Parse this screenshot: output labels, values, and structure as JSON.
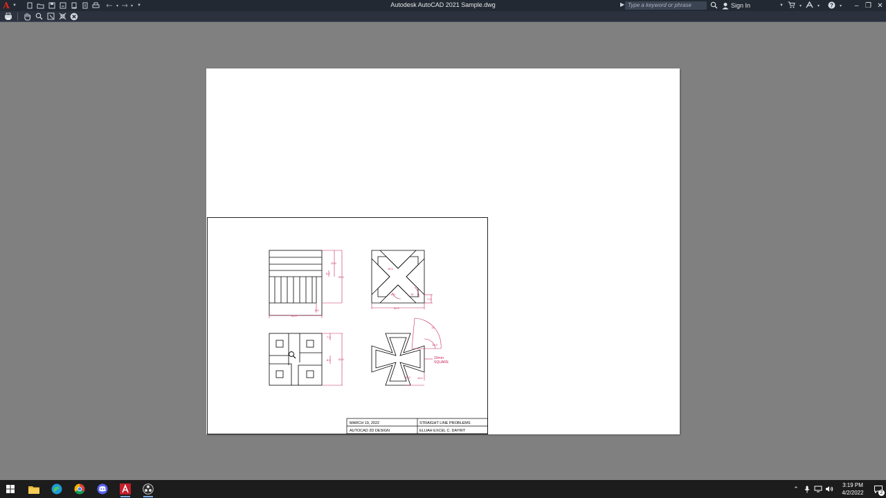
{
  "window": {
    "title": "Autodesk AutoCAD 2021   Sample.dwg",
    "search_placeholder": "Type a keyword or phrase",
    "sign_in": "Sign In"
  },
  "icons": {
    "quick_access": [
      "new-file-icon",
      "open-folder-icon",
      "save-icon",
      "save-as-icon",
      "web-open-icon",
      "web-save-icon",
      "plot-icon",
      "undo-icon",
      "redo-icon"
    ],
    "toolbar": [
      "print-icon",
      "pan-icon",
      "zoom-icon",
      "zoom-window-icon",
      "zoom-original-icon",
      "close-preview-icon"
    ],
    "taskbar": [
      "windows-start-icon",
      "file-explorer-icon",
      "edge-icon",
      "chrome-icon",
      "discord-icon",
      "autocad-icon",
      "obs-icon"
    ]
  },
  "drawing": {
    "dims_fig1": [
      "20.0",
      "8.0",
      "52.0",
      "42.0",
      "8.0"
    ],
    "dims_fig2": [
      "16.0",
      "15",
      "8.0",
      "7.0",
      "52.0"
    ],
    "dims_fig3": [
      "7.0",
      "8.0",
      "52.0"
    ],
    "dims_fig4": [
      "13",
      "15.0",
      "15.0",
      "16.0"
    ],
    "note_line1": "20mm",
    "note_line2": "SQUARE"
  },
  "title_block": {
    "date": "MARCH 19, 2022",
    "course": "AUTOCAD 2D DESIGN",
    "subject": "STRAIGHT LINE PROBLEMS",
    "author": "ELIJAH EXCEL C. DAYRIT"
  },
  "clock": {
    "time": "3:19 PM",
    "date": "4/2/2022"
  },
  "notifications_count": "2",
  "colors": {
    "dimension": "#c8285a",
    "object": "#000000",
    "background": "#808080",
    "titlebar": "#222933",
    "taskbar": "#1c1c1c"
  }
}
